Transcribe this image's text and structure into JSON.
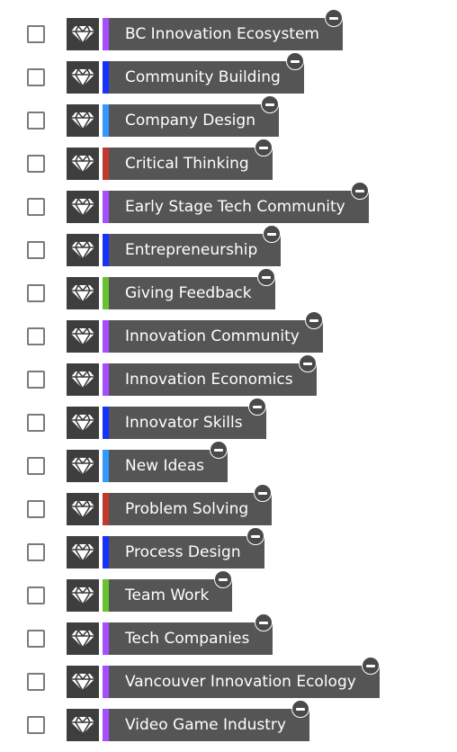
{
  "colors": {
    "purple": "#a64dff",
    "blue": "#1533ff",
    "lightblue": "#3399ff",
    "red": "#c0392b",
    "green": "#66c22e"
  },
  "tags": [
    {
      "label": "BC Innovation Ecosystem",
      "color": "#a64dff",
      "icon": "diamond-icon"
    },
    {
      "label": "Community Building",
      "color": "#1533ff",
      "icon": "diamond-icon"
    },
    {
      "label": "Company Design",
      "color": "#3399ff",
      "icon": "diamond-icon"
    },
    {
      "label": "Critical Thinking",
      "color": "#c0392b",
      "icon": "diamond-icon"
    },
    {
      "label": "Early Stage Tech Community",
      "color": "#a64dff",
      "icon": "diamond-icon"
    },
    {
      "label": "Entrepreneurship",
      "color": "#1533ff",
      "icon": "diamond-icon"
    },
    {
      "label": "Giving Feedback",
      "color": "#66c22e",
      "icon": "diamond-icon"
    },
    {
      "label": "Innovation Community",
      "color": "#a64dff",
      "icon": "diamond-icon"
    },
    {
      "label": "Innovation Economics",
      "color": "#a64dff",
      "icon": "diamond-icon"
    },
    {
      "label": "Innovator Skills",
      "color": "#1533ff",
      "icon": "diamond-icon"
    },
    {
      "label": "New Ideas",
      "color": "#3399ff",
      "icon": "diamond-icon"
    },
    {
      "label": "Problem Solving",
      "color": "#c0392b",
      "icon": "diamond-icon"
    },
    {
      "label": "Process Design",
      "color": "#1533ff",
      "icon": "diamond-icon"
    },
    {
      "label": "Team Work",
      "color": "#66c22e",
      "icon": "diamond-icon"
    },
    {
      "label": "Tech Companies",
      "color": "#a64dff",
      "icon": "diamond-icon"
    },
    {
      "label": "Vancouver Innovation Ecology",
      "color": "#a64dff",
      "icon": "diamond-icon"
    },
    {
      "label": "Video Game Industry",
      "color": "#a64dff",
      "icon": "diamond-icon"
    }
  ]
}
